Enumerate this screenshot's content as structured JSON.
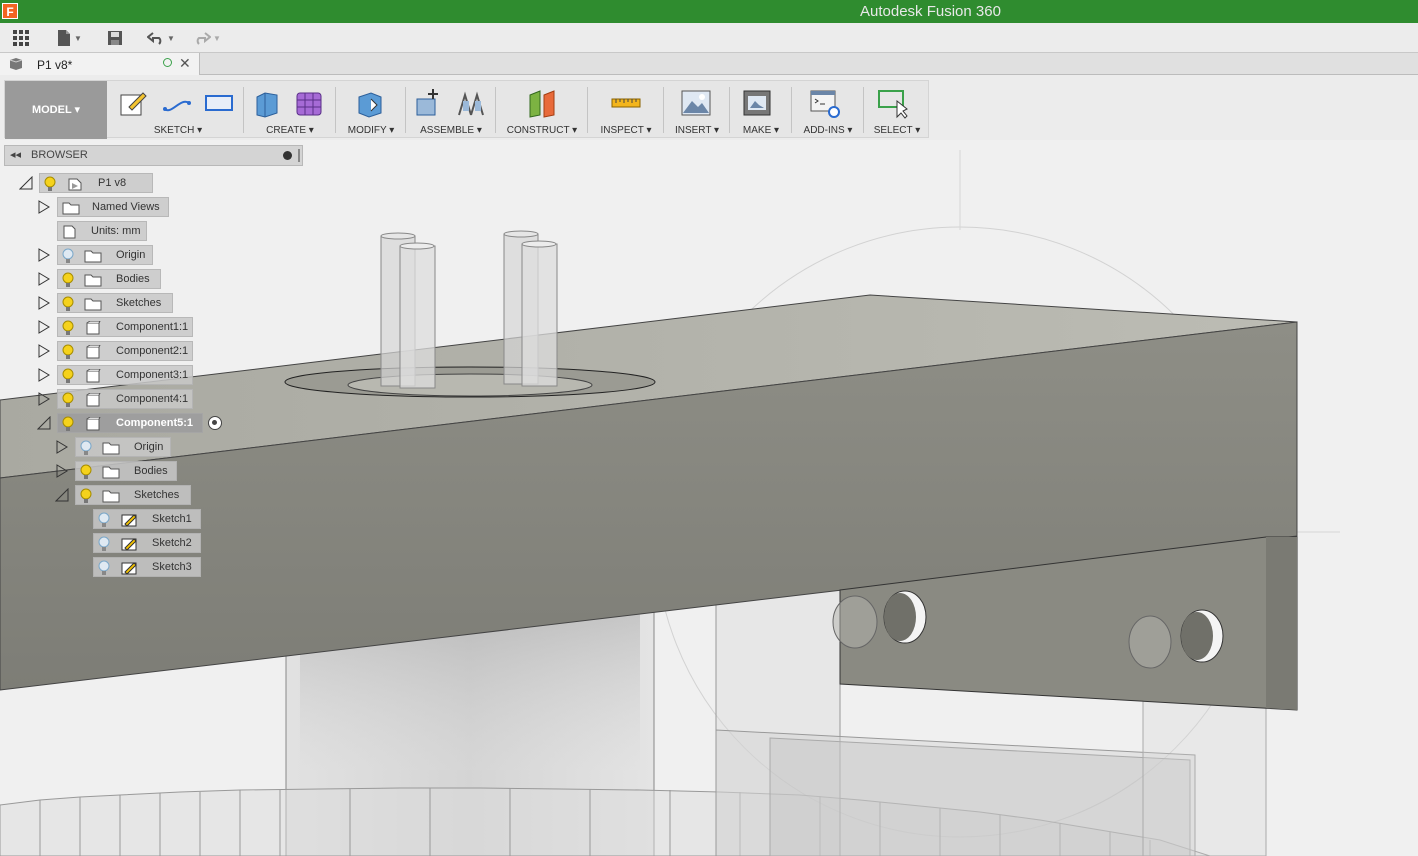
{
  "app": {
    "title": "Autodesk Fusion 360",
    "logo_letter": "F"
  },
  "quick_access": {
    "icons": [
      "grid-icon",
      "file-icon",
      "save-icon",
      "undo-icon",
      "redo-icon"
    ]
  },
  "document_tab": {
    "label": "P1 v8*"
  },
  "toolbar": {
    "workspace": "MODEL",
    "groups": [
      {
        "label": "SKETCH"
      },
      {
        "label": "CREATE"
      },
      {
        "label": "MODIFY"
      },
      {
        "label": "ASSEMBLE"
      },
      {
        "label": "CONSTRUCT"
      },
      {
        "label": "INSPECT"
      },
      {
        "label": "INSERT"
      },
      {
        "label": "MAKE"
      },
      {
        "label": "ADD-INS"
      },
      {
        "label": "SELECT"
      }
    ]
  },
  "browser": {
    "title": "BROWSER",
    "nodes": [
      {
        "label": "P1 v8"
      },
      {
        "label": "Named Views"
      },
      {
        "label": "Units: mm"
      },
      {
        "label": "Origin"
      },
      {
        "label": "Bodies"
      },
      {
        "label": "Sketches"
      },
      {
        "label": "Component1:1"
      },
      {
        "label": "Component2:1"
      },
      {
        "label": "Component3:1"
      },
      {
        "label": "Component4:1"
      },
      {
        "label": "Component5:1"
      },
      {
        "label": "Origin"
      },
      {
        "label": "Bodies"
      },
      {
        "label": "Sketches"
      },
      {
        "label": "Sketch1"
      },
      {
        "label": "Sketch2"
      },
      {
        "label": "Sketch3"
      }
    ]
  },
  "colors": {
    "title_bar": "#2f8c2f",
    "model_body": "#8a8a82",
    "model_top": "#b4b4ac",
    "bulb_on": "#f5d21c",
    "bulb_off": "#7aa7c9"
  }
}
